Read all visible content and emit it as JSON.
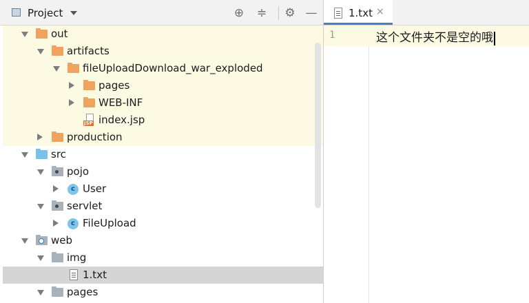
{
  "project_panel": {
    "title": "Project",
    "buttons": [
      {
        "name": "locate-icon",
        "glyph": "⊕"
      },
      {
        "name": "collapse-all-icon",
        "glyph": "≑"
      },
      {
        "name": "gear-icon",
        "glyph": "⚙"
      },
      {
        "name": "hide-icon",
        "glyph": "—"
      }
    ]
  },
  "tree": [
    {
      "label": "out",
      "indent": 0,
      "arrow": "down",
      "icon": "folder-orange",
      "state": "excluded"
    },
    {
      "label": "artifacts",
      "indent": 1,
      "arrow": "down",
      "icon": "folder-orange",
      "state": "excluded"
    },
    {
      "label": "fileUploadDownload_war_exploded",
      "indent": 2,
      "arrow": "down",
      "icon": "folder-orange",
      "state": "excluded"
    },
    {
      "label": "pages",
      "indent": 3,
      "arrow": "right",
      "icon": "folder-orange",
      "state": "excluded"
    },
    {
      "label": "WEB-INF",
      "indent": 3,
      "arrow": "right",
      "icon": "folder-orange",
      "state": "excluded"
    },
    {
      "label": "index.jsp",
      "indent": 3,
      "arrow": "none",
      "icon": "jsp-file",
      "state": "excluded"
    },
    {
      "label": "production",
      "indent": 1,
      "arrow": "right",
      "icon": "folder-orange",
      "state": "excluded"
    },
    {
      "label": "src",
      "indent": 0,
      "arrow": "down",
      "icon": "folder-blue",
      "state": "normal"
    },
    {
      "label": "pojo",
      "indent": 1,
      "arrow": "down",
      "icon": "package",
      "state": "normal"
    },
    {
      "label": "User",
      "indent": 2,
      "arrow": "right",
      "icon": "class",
      "state": "normal"
    },
    {
      "label": "servlet",
      "indent": 1,
      "arrow": "down",
      "icon": "package",
      "state": "normal"
    },
    {
      "label": "FileUpload",
      "indent": 2,
      "arrow": "right",
      "icon": "class",
      "state": "normal"
    },
    {
      "label": "web",
      "indent": 0,
      "arrow": "down",
      "icon": "web-folder",
      "state": "normal"
    },
    {
      "label": "img",
      "indent": 1,
      "arrow": "down",
      "icon": "folder-gray",
      "state": "normal"
    },
    {
      "label": "1.txt",
      "indent": 2,
      "arrow": "none",
      "icon": "txt-file",
      "state": "selected"
    },
    {
      "label": "pages",
      "indent": 1,
      "arrow": "down",
      "icon": "folder-gray",
      "state": "normal"
    }
  ],
  "editor": {
    "tab_label": "1.txt",
    "tab_close": "×",
    "line_number": "1",
    "line_text": "这个文件夹不是空的哦"
  }
}
